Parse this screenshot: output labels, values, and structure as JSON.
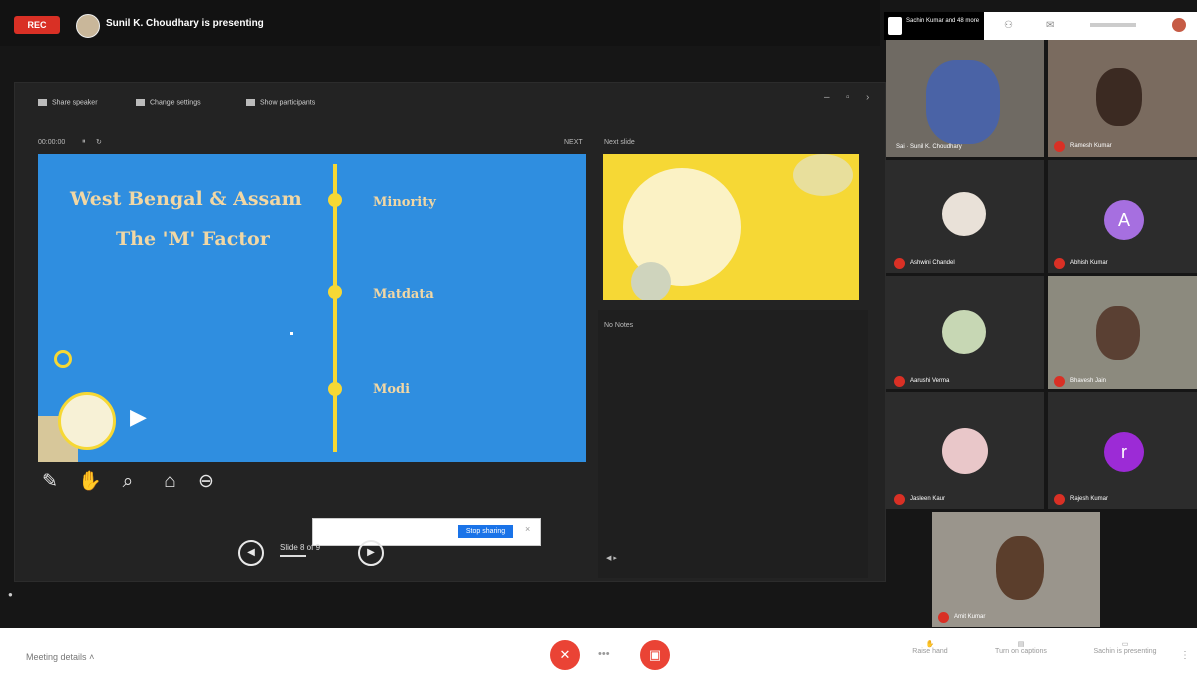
{
  "top_bar": {
    "rec_label": "REC",
    "presenter_text": "Sunil K. Choudhary is presenting"
  },
  "presenter_toolbar": {
    "items": [
      "Share speaker",
      "Change settings",
      "Show participants"
    ]
  },
  "slide_panel": {
    "current_label": "00:00:00",
    "next_small_label": "NEXT",
    "next_slide_label": "Next slide",
    "notes_label": "No Notes"
  },
  "slide": {
    "title_line1": "West Bengal & Assam",
    "title_line2": "The 'M' Factor",
    "items": [
      "Minority",
      "Matdata",
      "Modi"
    ]
  },
  "navigation": {
    "prev_icon": "chevron-left-icon",
    "next_icon": "chevron-right-icon",
    "slide_counter": "Slide 8 of 9"
  },
  "search_popup": {
    "placeholder": "",
    "button_label": "Stop sharing"
  },
  "participants": {
    "you_chip": "Sachin Kumar and 48 more",
    "tiles": [
      {
        "name": "Sai · Sunil K. Choudhary"
      },
      {
        "name": "Ramesh Kumar"
      },
      {
        "name": "Ashwini Chandel"
      },
      {
        "name": "Abhish Kumar",
        "initial": "A"
      },
      {
        "name": "Aarushi Verma"
      },
      {
        "name": "Bhavesh Jain"
      },
      {
        "name": "Jasleen Kaur"
      },
      {
        "name": "Rajesh Kumar",
        "initial": "r"
      },
      {
        "name": "Amit Kumar"
      }
    ]
  },
  "bottom_bar": {
    "meeting_details": "Meeting details",
    "mic_icon": "mic-off-icon",
    "more_icon": "more-icon",
    "camera_icon": "camera-off-icon",
    "actions": [
      "Raise hand",
      "Turn on captions",
      "Sachin is presenting"
    ]
  },
  "colors": {
    "slide_bg": "#2f8ee0",
    "timeline": "#f6d835",
    "record": "#d93025",
    "call_red": "#ea4335",
    "stop_button": "#1a73e8"
  }
}
